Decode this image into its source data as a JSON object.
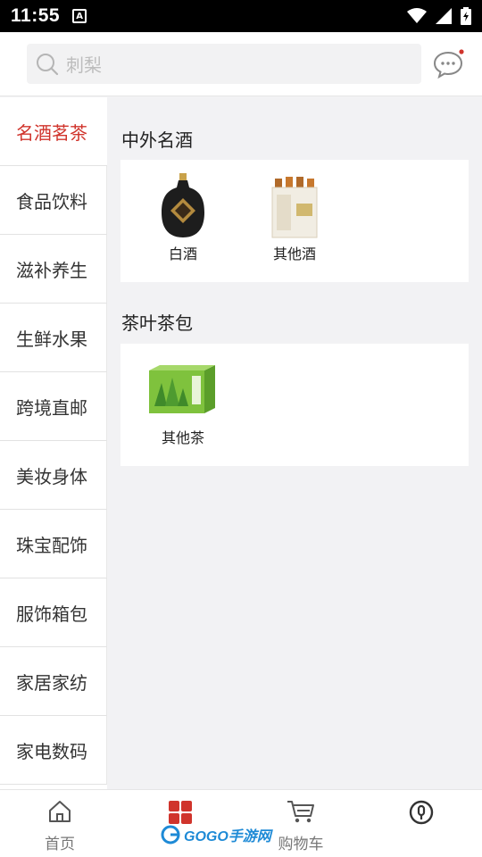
{
  "status_bar": {
    "time": "11:55",
    "notification_icon": "A"
  },
  "search": {
    "placeholder": "刺梨"
  },
  "sidebar": {
    "items": [
      {
        "label": "名酒茗茶",
        "active": true
      },
      {
        "label": "食品饮料"
      },
      {
        "label": "滋补养生"
      },
      {
        "label": "生鲜水果"
      },
      {
        "label": "跨境直邮"
      },
      {
        "label": "美妆身体"
      },
      {
        "label": "珠宝配饰"
      },
      {
        "label": "服饰箱包"
      },
      {
        "label": "家居家纺"
      },
      {
        "label": "家电数码"
      }
    ]
  },
  "main": {
    "sections": [
      {
        "title": "中外名酒",
        "products": [
          {
            "label": "白酒",
            "icon": "baijiu-bottle"
          },
          {
            "label": "其他酒",
            "icon": "wine-box"
          }
        ]
      },
      {
        "title": "茶叶茶包",
        "products": [
          {
            "label": "其他茶",
            "icon": "tea-box"
          }
        ]
      }
    ]
  },
  "bottom_nav": {
    "items": [
      {
        "label": "首页",
        "icon": "home-icon"
      },
      {
        "label": "",
        "icon": "category-icon"
      },
      {
        "label": "购物车",
        "icon": "cart-icon"
      },
      {
        "label": "",
        "icon": "profile-icon"
      }
    ],
    "watermark": "GOGO手游网"
  },
  "colors": {
    "accent": "#d0342c",
    "background": "#f2f2f4"
  }
}
